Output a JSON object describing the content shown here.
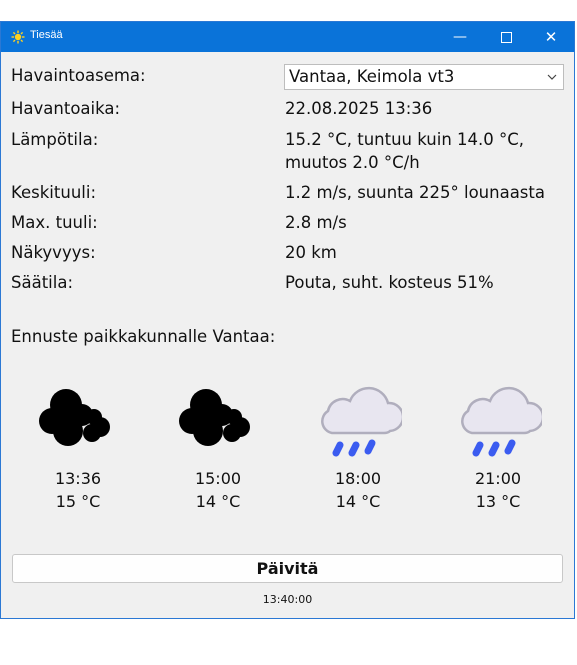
{
  "window": {
    "title": "Tiesää"
  },
  "fields": [
    {
      "label": "Havaintoasema:",
      "value": "Vantaa, Keimola vt3"
    },
    {
      "label": "Havantoaika:",
      "value": "22.08.2025 13:36"
    },
    {
      "label": "Lämpötila:",
      "value_line1": "15.2 °C, tuntuu kuin 14.0 °C,",
      "value_line2": "muutos 2.0 °C/h"
    },
    {
      "label": "Keskituuli:",
      "value": "1.2 m/s, suunta 225° lounaasta"
    },
    {
      "label": "Max. tuuli:",
      "value": "2.8 m/s"
    },
    {
      "label": "Näkyvyys:",
      "value": "20 km"
    },
    {
      "label": "Säätila:",
      "value": "Pouta, suht. kosteus 51%"
    }
  ],
  "forecast": {
    "title": "Ennuste paikkakunnalle Vantaa:",
    "items": [
      {
        "time": "13:36",
        "temp": "15 °C",
        "icon": "broken-cloud-icon"
      },
      {
        "time": "15:00",
        "temp": "14 °C",
        "icon": "broken-cloud-icon"
      },
      {
        "time": "18:00",
        "temp": "14 °C",
        "icon": "rain-cloud-icon"
      },
      {
        "time": "21:00",
        "temp": "13 °C",
        "icon": "rain-cloud-icon"
      }
    ]
  },
  "actions": {
    "refresh_label": "Päivitä"
  },
  "status": {
    "updated_time": "13:40:00"
  },
  "colors": {
    "titlebar": "#0a73d9",
    "rain": "#3b5cf0",
    "cloud": "#e8e6f0",
    "cloud_outline": "#b0aebd"
  }
}
